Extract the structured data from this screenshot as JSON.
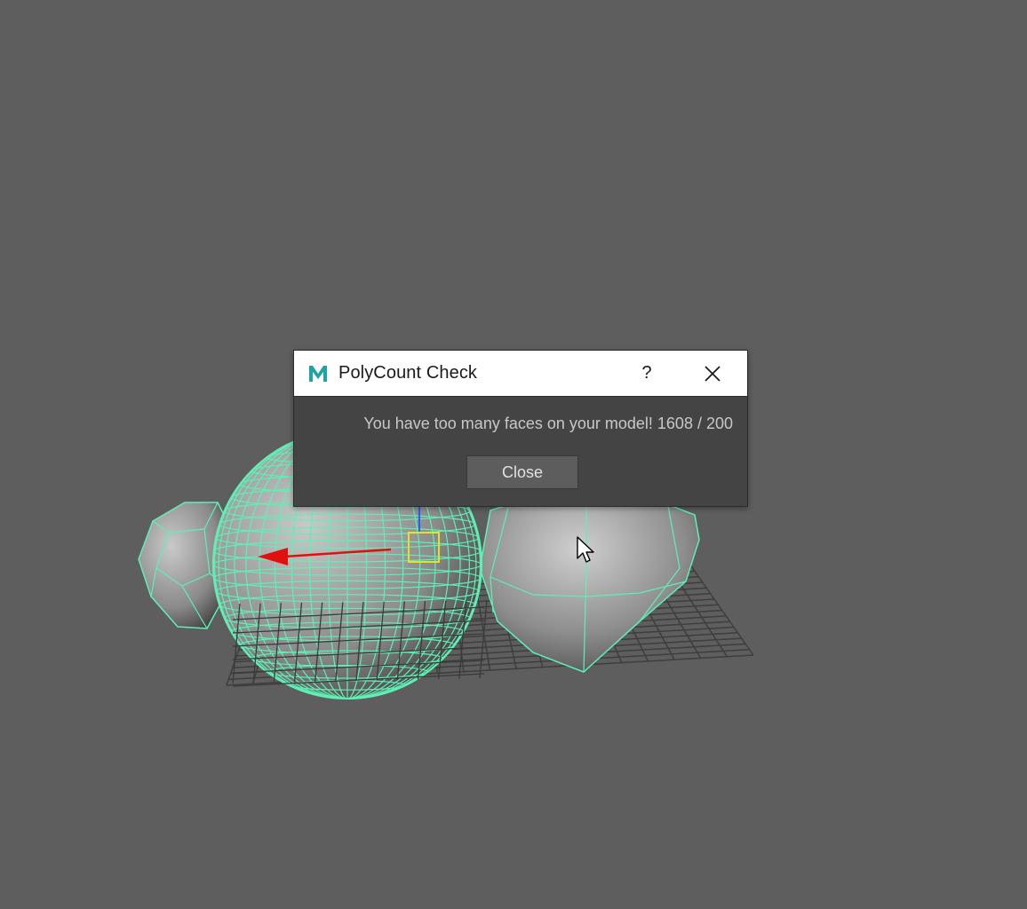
{
  "dialog": {
    "title": "PolyCount Check",
    "logo_letter": "M",
    "help_label": "?",
    "message": "You have too many faces on your model! 1608 / 200",
    "close_button_label": "Close"
  },
  "icons": {
    "logo": "maya-logo-icon",
    "help": "question-icon",
    "close": "close-icon",
    "cursor": "mouse-cursor-icon"
  },
  "colors": {
    "viewport_bg": "#5e5e5e",
    "wireframe": "#5ef0b4",
    "dialog_bg": "#444444",
    "titlebar_bg": "#ffffff",
    "logo_accent": "#1fa3a7",
    "gizmo_x": "#e01010",
    "gizmo_center": "#e8e020",
    "gizmo_y": "#2060ff"
  }
}
